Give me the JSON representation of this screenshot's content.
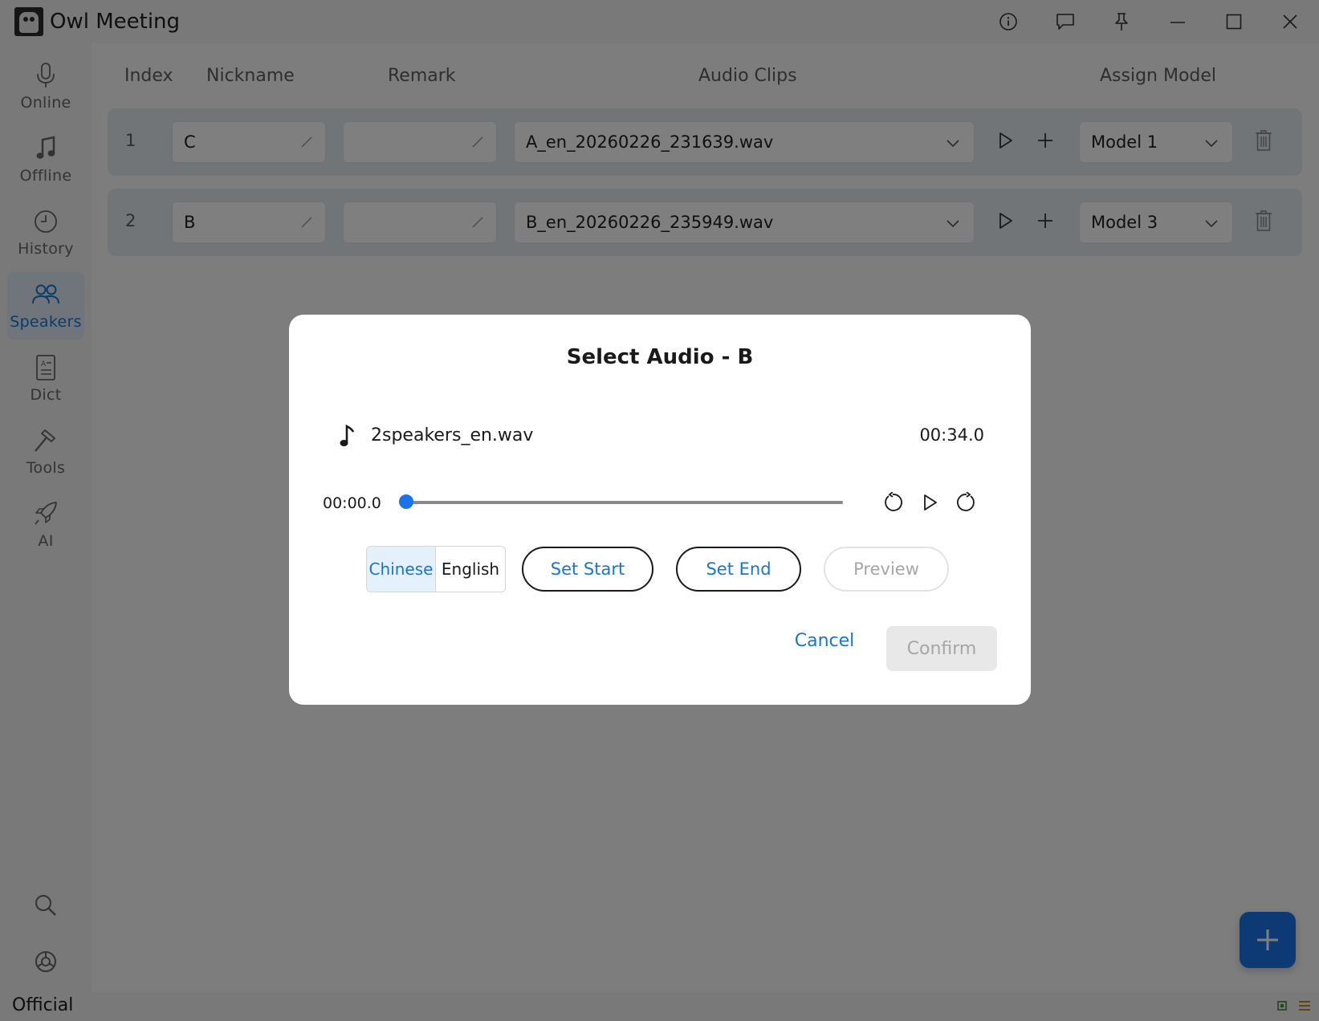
{
  "app": {
    "title": "Owl Meeting"
  },
  "titlebar_icons": [
    "info-icon",
    "feedback-icon",
    "pin-icon",
    "minimize-icon",
    "maximize-icon",
    "close-icon"
  ],
  "sidebar": {
    "items": [
      {
        "label": "Online",
        "icon": "microphone-icon",
        "active": false
      },
      {
        "label": "Offline",
        "icon": "music-note-icon",
        "active": false
      },
      {
        "label": "History",
        "icon": "clock-icon",
        "active": false
      },
      {
        "label": "Speakers",
        "icon": "speakers-icon",
        "active": true
      },
      {
        "label": "Dict",
        "icon": "dictionary-icon",
        "active": false
      },
      {
        "label": "Tools",
        "icon": "hammer-icon",
        "active": false
      },
      {
        "label": "AI",
        "icon": "rocket-icon",
        "active": false
      }
    ],
    "bottom_icons": [
      "search-icon",
      "settings-icon"
    ]
  },
  "table": {
    "headers": {
      "index": "Index",
      "nickname": "Nickname",
      "remark": "Remark",
      "audio_clips": "Audio Clips",
      "assign_model": "Assign Model"
    },
    "rows": [
      {
        "index": "1",
        "nickname": "C",
        "remark": "",
        "audio_clip": "A_en_20260226_231639.wav",
        "model": "Model 1"
      },
      {
        "index": "2",
        "nickname": "B",
        "remark": "",
        "audio_clip": "B_en_20260226_235949.wav",
        "model": "Model 3"
      }
    ]
  },
  "status": {
    "label": "Official",
    "accent": "#1a73e8"
  },
  "dialog": {
    "title": "Select Audio - B",
    "file_name": "2speakers_en.wav",
    "duration": "00:34.0",
    "current_time": "00:00.0",
    "progress_fraction": 0.0,
    "language_options": [
      "Chinese",
      "English"
    ],
    "selected_language": "Chinese",
    "set_start_label": "Set Start",
    "set_end_label": "Set End",
    "preview_label": "Preview",
    "cancel_label": "Cancel",
    "confirm_label": "Confirm"
  }
}
